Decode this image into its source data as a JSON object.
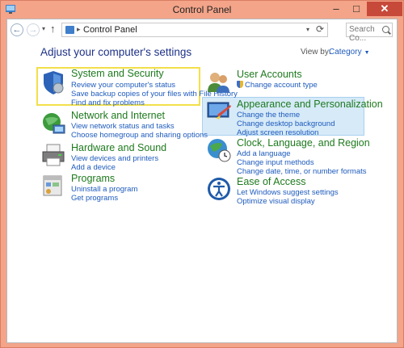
{
  "window": {
    "title": "Control Panel"
  },
  "navigation": {
    "address_crumb": "Control Panel",
    "search_placeholder": "Search Co..."
  },
  "header": {
    "heading": "Adjust your computer's settings",
    "view_by_label": "View by:",
    "view_by_value": "Category"
  },
  "categories": [
    {
      "title": "System and Security",
      "links": [
        "Review your computer's status",
        "Save backup copies of your files with File History",
        "Find and fix problems"
      ]
    },
    {
      "title": "Network and Internet",
      "links": [
        "View network status and tasks",
        "Choose homegroup and sharing options"
      ]
    },
    {
      "title": "Hardware and Sound",
      "links": [
        "View devices and printers",
        "Add a device"
      ]
    },
    {
      "title": "Programs",
      "links": [
        "Uninstall a program",
        "Get programs"
      ]
    },
    {
      "title": "User Accounts",
      "links": [
        "Change account type"
      ]
    },
    {
      "title": "Appearance and Personalization",
      "links": [
        "Change the theme",
        "Change desktop background",
        "Adjust screen resolution"
      ]
    },
    {
      "title": "Clock, Language, and Region",
      "links": [
        "Add a language",
        "Change input methods",
        "Change date, time, or number formats"
      ]
    },
    {
      "title": "Ease of Access",
      "links": [
        "Let Windows suggest settings",
        "Optimize visual display"
      ]
    }
  ],
  "colors": {
    "title_bar": "#f3a489",
    "category_title": "#1e7a1e",
    "link": "#1e5bbd",
    "heading": "#1e3287",
    "highlight_yellow": "#f2df4a",
    "highlight_blue": "#d6eaf8",
    "close_button": "#c7493a"
  }
}
